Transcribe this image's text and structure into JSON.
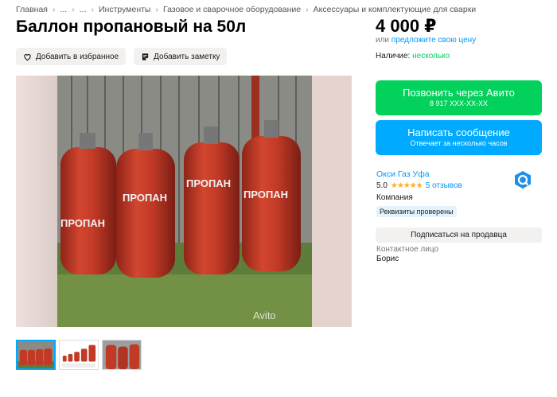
{
  "breadcrumb": [
    "Главная",
    "...",
    "...",
    "Инструменты",
    "Газовое и сварочное оборудование",
    "Аксессуары и комплектующие для сварки"
  ],
  "title": "Баллон пропановый на 50л",
  "actions": {
    "favorite": "Добавить в избранное",
    "note": "Добавить заметку"
  },
  "gallery": {
    "main_image_caption": "Avito",
    "cylinder_text": "ПРОПАН",
    "thumbnail_count": 3,
    "active_thumbnail": 1
  },
  "price": {
    "value": "4 000 ₽",
    "or_text": "или",
    "offer_link": "предложите свою цену"
  },
  "availability": {
    "label": "Наличие:",
    "value": "несколько"
  },
  "call_button": {
    "label": "Позвонить через Авито",
    "phone": "8 917 XXX-XX-XX"
  },
  "message_button": {
    "label": "Написать сообщение",
    "sub": "Отвечает за несколько часов"
  },
  "seller": {
    "name": "Окси Газ Уфа",
    "rating": "5.0",
    "stars": "★★★★★",
    "reviews": "5 отзывов",
    "type": "Компания",
    "badge": "Реквизиты проверены"
  },
  "subscribe_button": "Подписаться на продавца",
  "contact": {
    "label": "Контактное лицо",
    "name": "Борис"
  },
  "colors": {
    "green": "#02d15c",
    "blue": "#00aaff",
    "link": "#0099f7",
    "cylinder_red": "#c0392b"
  }
}
